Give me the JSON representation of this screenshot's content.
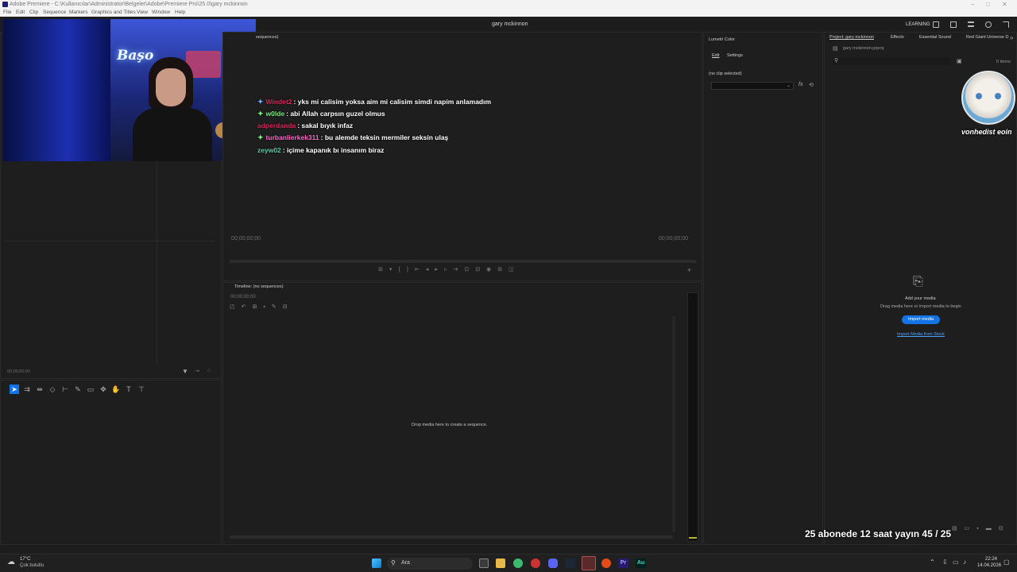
{
  "window": {
    "title": "Adobe Premiere - C:\\Kullanıcılar\\Administrator\\Belgeler\\Adobe\\Premiere Pro\\25.0\\gary mckinnon",
    "controls": [
      "–",
      "□",
      "✕"
    ]
  },
  "menu": [
    "File",
    "Edit",
    "Clip",
    "Sequence",
    "Markers",
    "Graphics and Titles",
    "View",
    "Window",
    "Help"
  ],
  "header": {
    "project_name": "gary mckinnon",
    "learning_label": "LEARNING"
  },
  "source_monitor": {
    "tab": "sequences)",
    "timecode": "00;00;00;00"
  },
  "program_monitor": {
    "timecode_left": "00;00;00;00",
    "timecode_right": "00;00;00;00"
  },
  "lumetri": {
    "title": "Lumetri Color",
    "tab_edit": "Edit",
    "tab_settings": "Settings",
    "clip_status": "(no clip selected)",
    "fx_label": "fx"
  },
  "project": {
    "tabs": [
      "Project: gary mckinnon",
      "Effects",
      "Essential Sound",
      "Red Giant Universe D"
    ],
    "file_name": "gary mckinnon.prproj",
    "items_count": "0 items",
    "empty_title": "Add your media",
    "empty_desc": "Drag media here or import media to begin",
    "import_button": "Import media",
    "stock_link": "Import Media from Stock"
  },
  "timeline": {
    "title": "Timeline: (no sequences)",
    "timecode": "00;00;00;00",
    "drop_hint": "Drop media here to create a sequence."
  },
  "chat": [
    {
      "user": "Windet2",
      "user_color": "#e0245e",
      "badge": "✦",
      "message": ": yks mi calisim yoksa aim mi calisim simdi napim anlamadım"
    },
    {
      "user": "w0lde",
      "user_color": "#7ce87c",
      "badge": "✦",
      "message": ": abi Allah carpsın guzel olmus"
    },
    {
      "user": "adperdanda",
      "user_color": "#e0245e",
      "badge": "",
      "message": ": sakal bıyık infaz"
    },
    {
      "user": "turbanlierkek311",
      "user_color": "#ff69c8",
      "badge": "✦",
      "message": ": bu alemde teksin mermiler seksin ulaş"
    },
    {
      "user": "zeyw02",
      "user_color": "#5ec8a6",
      "badge": "",
      "message": ": içime kapanık bı insanım biraz"
    }
  ],
  "webcam": {
    "neon_sign": "Başo"
  },
  "cat_badge": {
    "label": "vonhedist eoin"
  },
  "overlay": {
    "subscriber_goal": "25 abonede 12 saat yayın 45 / 25"
  },
  "taskbar": {
    "weather_temp": "17°C",
    "weather_desc": "Çok bulutlu",
    "search_label": "Ara",
    "time": "22:24",
    "date": "14.04.2026",
    "pr_label": "Pr",
    "au_label": "Au"
  },
  "colors": {
    "accent_blue": "#1473e6",
    "bg": "#1d1d1d",
    "taskbar": "#202020"
  }
}
